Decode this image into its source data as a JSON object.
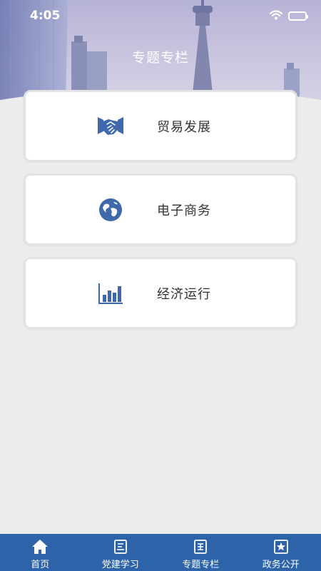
{
  "status_bar": {
    "time": "4:05"
  },
  "header": {
    "title": "专题专栏"
  },
  "cards": [
    {
      "label": "贸易发展",
      "icon": "handshake-icon"
    },
    {
      "label": "电子商务",
      "icon": "globe-icon"
    },
    {
      "label": "经济运行",
      "icon": "bar-chart-icon"
    }
  ],
  "tabbar": {
    "tabs": [
      {
        "label": "首页",
        "icon": "home-icon"
      },
      {
        "label": "党建学习",
        "icon": "book-icon"
      },
      {
        "label": "专题专栏",
        "icon": "document-icon"
      },
      {
        "label": "政务公开",
        "icon": "star-icon"
      }
    ]
  },
  "colors": {
    "accent": "#2d63a8",
    "icon_blue": "#3f69ab",
    "background": "#ececec"
  }
}
